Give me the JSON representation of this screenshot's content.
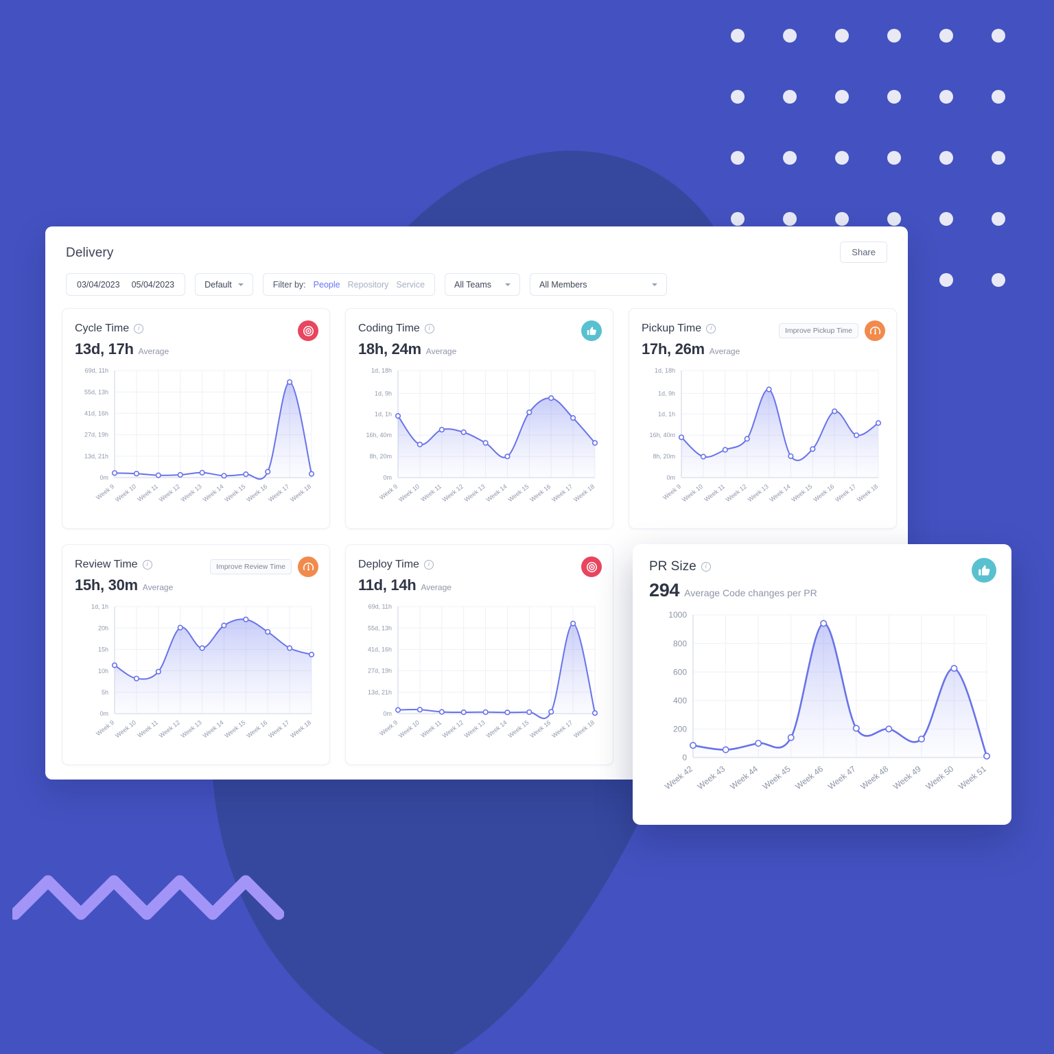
{
  "background": {
    "base_color": "#4352c0",
    "blob_color": "#36489e",
    "zigzag_color": "#a395f7",
    "dot_color": "#e8e9f5",
    "dot_rows": 5,
    "dot_cols": 6
  },
  "header": {
    "title": "Delivery",
    "share_label": "Share"
  },
  "toolbar": {
    "date_from": "03/04/2023",
    "date_to": "05/04/2023",
    "preset_label": "Default",
    "filter_label": "Filter by:",
    "filter_options": [
      "People",
      "Repository",
      "Service"
    ],
    "filter_active": "People",
    "teams_label": "All Teams",
    "members_label": "All Members"
  },
  "cards": [
    {
      "title": "Cycle Time",
      "metric_value": "13d, 17h",
      "metric_unit": "Average",
      "badge": "target-icon",
      "badge_color": "#e8455f",
      "pill": null
    },
    {
      "title": "Coding Time",
      "metric_value": "18h, 24m",
      "metric_unit": "Average",
      "badge": "thumbs-up-icon",
      "badge_color": "#59c0cf",
      "pill": null
    },
    {
      "title": "Pickup Time",
      "metric_value": "17h, 26m",
      "metric_unit": "Average",
      "badge": "gauge-icon",
      "badge_color": "#f08b4d",
      "pill": "Improve Pickup Time"
    },
    {
      "title": "Review Time",
      "metric_value": "15h, 30m",
      "metric_unit": "Average",
      "badge": "gauge-icon",
      "badge_color": "#f08b4d",
      "pill": "Improve Review Time"
    },
    {
      "title": "Deploy Time",
      "metric_value": "11d, 14h",
      "metric_unit": "Average",
      "badge": "target-icon",
      "badge_color": "#e8455f",
      "pill": null
    }
  ],
  "pr_card": {
    "title": "PR Size",
    "metric_value": "294",
    "metric_unit": "Average Code changes per PR",
    "badge": "thumbs-up-icon",
    "badge_color": "#59c0cf"
  },
  "chart_data": [
    {
      "type": "area",
      "title": "Cycle Time",
      "xlabel": "",
      "ylabel": "",
      "categories": [
        "Week 9",
        "Week 10",
        "Week 11",
        "Week 12",
        "Week 13",
        "Week 14",
        "Week 15",
        "Week 16",
        "Week 17",
        "Week 18"
      ],
      "ytick_labels": [
        "0m",
        "13d, 21h",
        "27d, 19h",
        "41d, 16h",
        "55d, 13h",
        "69d, 11h"
      ],
      "ytick_values": [
        0,
        13.875,
        27.79,
        41.67,
        55.54,
        69.46
      ],
      "ylim": [
        0,
        69.46
      ],
      "values": [
        3.0,
        2.6,
        1.5,
        1.8,
        3.2,
        1.2,
        2.2,
        3.8,
        62.0,
        2.4
      ],
      "grid": true,
      "legend": "none"
    },
    {
      "type": "area",
      "title": "Coding Time",
      "xlabel": "",
      "ylabel": "",
      "categories": [
        "Week 9",
        "Week 10",
        "Week 11",
        "Week 12",
        "Week 13",
        "Week 14",
        "Week 15",
        "Week 16",
        "Week 17",
        "Week 18"
      ],
      "ytick_labels": [
        "0m",
        "8h, 20m",
        "16h, 40m",
        "1d, 1h",
        "1d, 9h",
        "1d, 18h"
      ],
      "ytick_values": [
        0,
        8.33,
        16.67,
        25.0,
        33.0,
        42.0
      ],
      "ylim": [
        0,
        42.0
      ],
      "values": [
        24.2,
        13.0,
        18.8,
        17.8,
        13.6,
        8.3,
        25.6,
        31.2,
        23.4,
        13.6
      ],
      "grid": true,
      "legend": "none"
    },
    {
      "type": "area",
      "title": "Pickup Time",
      "xlabel": "",
      "ylabel": "",
      "categories": [
        "Week 9",
        "Week 10",
        "Week 11",
        "Week 12",
        "Week 13",
        "Week 14",
        "Week 15",
        "Week 16",
        "Week 17",
        "Week 18"
      ],
      "ytick_labels": [
        "0m",
        "8h, 20m",
        "16h, 40m",
        "1d, 1h",
        "1d, 9h",
        "1d, 18h"
      ],
      "ytick_values": [
        0,
        8.33,
        16.67,
        25.0,
        33.0,
        42.0
      ],
      "ylim": [
        0,
        42.0
      ],
      "values": [
        15.8,
        8.2,
        10.9,
        15.2,
        34.6,
        8.4,
        11.2,
        26.0,
        16.6,
        21.4
      ],
      "grid": true,
      "legend": "none"
    },
    {
      "type": "area",
      "title": "Review Time",
      "xlabel": "",
      "ylabel": "",
      "categories": [
        "Week 9",
        "Week 10",
        "Week 11",
        "Week 12",
        "Week 13",
        "Week 14",
        "Week 15",
        "Week 16",
        "Week 17",
        "Week 18"
      ],
      "ytick_labels": [
        "0m",
        "5h",
        "10h",
        "15h",
        "20h",
        "1d, 1h"
      ],
      "ytick_values": [
        0,
        5,
        10,
        15,
        20,
        25
      ],
      "ylim": [
        0,
        25
      ],
      "values": [
        11.3,
        8.2,
        9.8,
        20.1,
        15.3,
        20.6,
        22.0,
        19.1,
        15.3,
        13.8
      ],
      "grid": true,
      "legend": "none"
    },
    {
      "type": "area",
      "title": "Deploy Time",
      "xlabel": "",
      "ylabel": "",
      "categories": [
        "Week 9",
        "Week 10",
        "Week 11",
        "Week 12",
        "Week 13",
        "Week 14",
        "Week 15",
        "Week 16",
        "Week 17",
        "Week 18"
      ],
      "ytick_labels": [
        "0m",
        "13d, 21h",
        "27d, 19h",
        "41d, 16h",
        "55d, 13h",
        "69d, 11h"
      ],
      "ytick_values": [
        0,
        13.875,
        27.79,
        41.67,
        55.54,
        69.46
      ],
      "ylim": [
        0,
        69.46
      ],
      "values": [
        2.4,
        2.6,
        1.1,
        0.9,
        1.0,
        0.8,
        1.0,
        1.2,
        58.5,
        0.4
      ],
      "grid": true,
      "legend": "none"
    },
    {
      "type": "area",
      "title": "PR Size",
      "xlabel": "",
      "ylabel": "",
      "categories": [
        "Week 42",
        "Week 43",
        "Week 44",
        "Week 45",
        "Week 46",
        "Week 47",
        "Week 48",
        "Week 49",
        "Week 50",
        "Week 51"
      ],
      "ytick_labels": [
        "0",
        "200",
        "400",
        "600",
        "800",
        "1000"
      ],
      "ytick_values": [
        0,
        200,
        400,
        600,
        800,
        1000
      ],
      "ylim": [
        0,
        1000
      ],
      "values": [
        85,
        55,
        100,
        140,
        940,
        205,
        200,
        130,
        625,
        10
      ],
      "grid": true,
      "legend": "none"
    }
  ]
}
